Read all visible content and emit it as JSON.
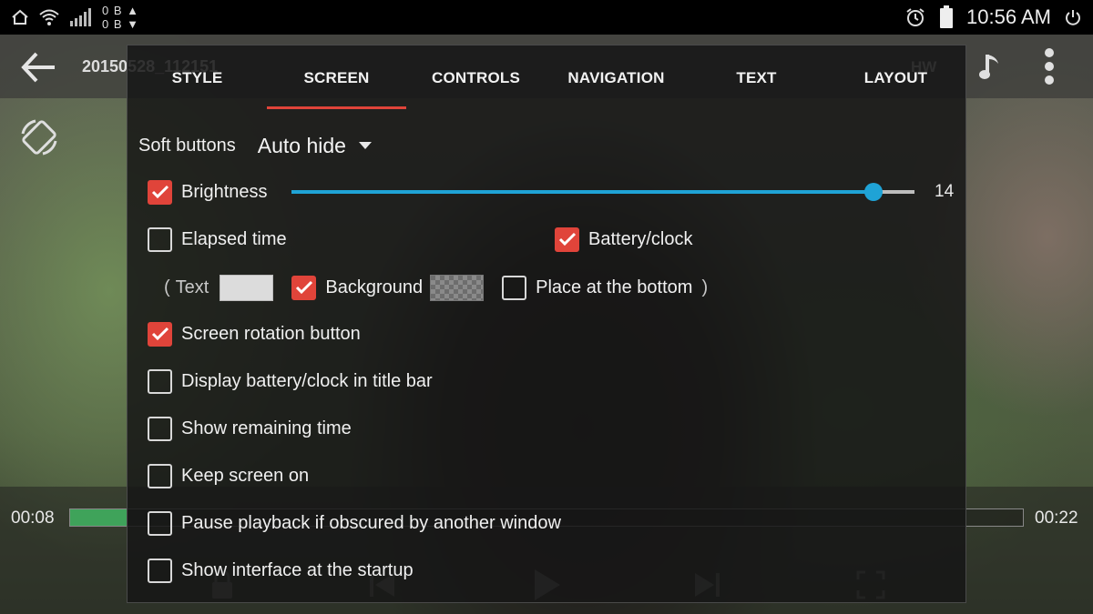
{
  "status_bar": {
    "net_up": "0 B ▲",
    "net_down": "0 B ▼",
    "time": "10:56 AM",
    "icons": [
      "home-icon",
      "wifi-icon",
      "signal-icon",
      "alarm-icon",
      "battery-icon",
      "power-icon"
    ]
  },
  "player": {
    "title": "20150528_112151",
    "decoder": "HW",
    "elapsed": "00:08",
    "total": "00:22",
    "progress_fraction": 0.06
  },
  "dialog": {
    "tabs": [
      {
        "label": "STYLE",
        "active": false
      },
      {
        "label": "SCREEN",
        "active": true
      },
      {
        "label": "CONTROLS",
        "active": false
      },
      {
        "label": "NAVIGATION",
        "active": false
      },
      {
        "label": "TEXT",
        "active": false
      },
      {
        "label": "LAYOUT",
        "active": false
      }
    ],
    "soft_buttons": {
      "label": "Soft buttons",
      "value": "Auto hide"
    },
    "brightness": {
      "label": "Brightness",
      "checked": true,
      "value": "14",
      "fraction": 0.934
    },
    "elapsed_time": {
      "label": "Elapsed time",
      "checked": false
    },
    "battery_clock": {
      "label": "Battery/clock",
      "checked": true
    },
    "text_color": {
      "open_paren": "(",
      "label": "Text",
      "color": "#dcdcdc"
    },
    "background": {
      "label": "Background",
      "checked": true
    },
    "place_bottom": {
      "label": "Place at the bottom",
      "checked": false,
      "close_paren": ")"
    },
    "options": [
      {
        "label": "Screen rotation button",
        "checked": true
      },
      {
        "label": "Display battery/clock in title bar",
        "checked": false
      },
      {
        "label": "Show remaining time",
        "checked": false
      },
      {
        "label": "Keep screen on",
        "checked": false
      },
      {
        "label": "Pause playback if obscured by another window",
        "checked": false
      },
      {
        "label": "Show interface at the startup",
        "checked": false
      }
    ]
  },
  "colors": {
    "accent_red": "#e0443a",
    "slider_blue": "#1fa3d6",
    "seek_green": "#3fa35a"
  }
}
